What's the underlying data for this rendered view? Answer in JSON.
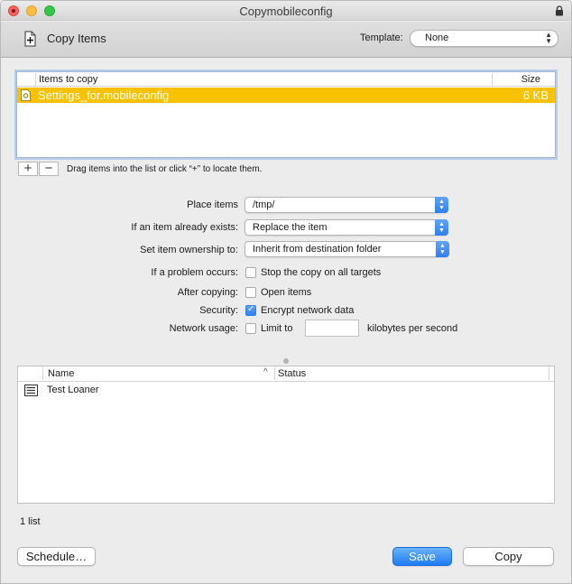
{
  "window": {
    "title": "Copymobileconfig"
  },
  "toolbar": {
    "title": "Copy Items",
    "template_label": "Template:",
    "template_value": "None"
  },
  "items": {
    "columns": [
      "Items to copy",
      "Size"
    ],
    "rows": [
      {
        "name": "Settings_for.mobileconfig",
        "size": "6 KB",
        "selected": true
      }
    ],
    "hint": "Drag items into the list or click “+” to locate them."
  },
  "form": {
    "place_items": {
      "label": "Place items",
      "value": "/tmp/"
    },
    "if_exists": {
      "label": "If an item already exists:",
      "value": "Replace the item"
    },
    "ownership": {
      "label": "Set item ownership to:",
      "value": "Inherit from destination folder"
    },
    "problem": {
      "label": "If a problem occurs:",
      "option": "Stop the copy on all targets",
      "checked": false
    },
    "after": {
      "label": "After copying:",
      "option": "Open items",
      "checked": false
    },
    "security": {
      "label": "Security:",
      "option": "Encrypt network data",
      "checked": true
    },
    "network": {
      "label": "Network usage:",
      "option": "Limit to",
      "value": "",
      "units": "kilobytes per second",
      "checked": false
    }
  },
  "lists": {
    "columns": [
      "Name",
      "Status"
    ],
    "rows": [
      {
        "name": "Test Loaner",
        "status": ""
      }
    ],
    "count": "1 list"
  },
  "buttons": {
    "schedule": "Schedule…",
    "save": "Save",
    "copy": "Copy"
  },
  "colors": {
    "selection": "#f9c200",
    "accent": "#2f7ff0"
  }
}
